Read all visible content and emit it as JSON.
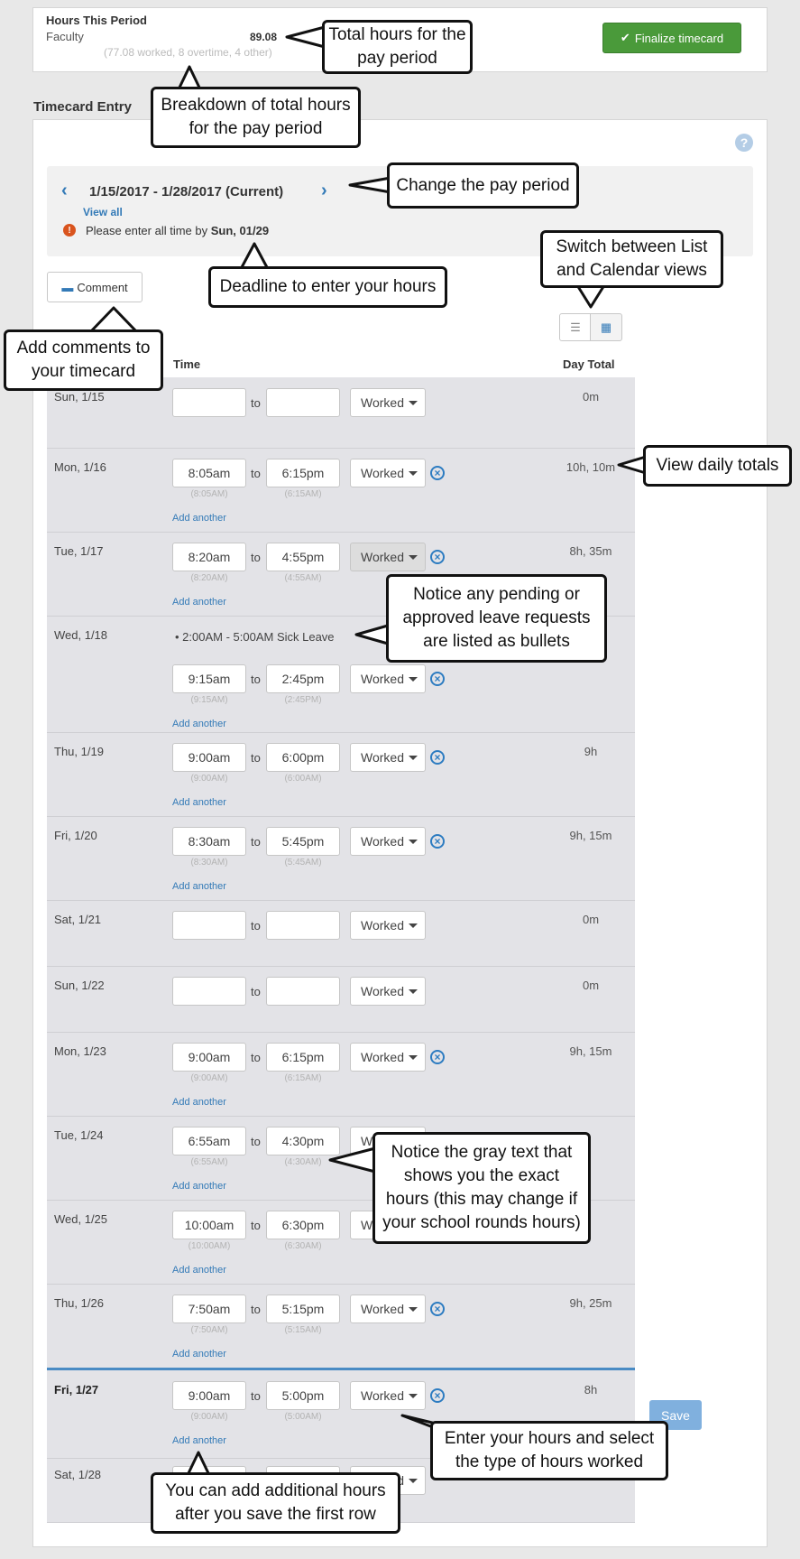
{
  "summary": {
    "label": "Hours This Period",
    "category": "Faculty",
    "total": "89.08",
    "breakdown": "(77.08 worked, 8 overtime, 4 other)",
    "finalize_label": "Finalize timecard"
  },
  "entry": {
    "heading": "Timecard Entry",
    "period": "1/15/2017 - 1/28/2017 (Current)",
    "view_all": "View all",
    "deadline_text": "Please enter all time by",
    "deadline_date": "Sun, 01/29",
    "comment_label": "Comment",
    "col_time": "Time",
    "col_day_total": "Day Total",
    "to_label": "to",
    "add_another": "Add another",
    "save_label": "Save",
    "leave_bullet": "2:00AM - 5:00AM Sick Leave"
  },
  "rows": [
    {
      "day": "Sun, 1/15",
      "start": "",
      "end": "",
      "start_hint": "",
      "end_hint": "",
      "type": "Worked",
      "total": "0m"
    },
    {
      "day": "Mon, 1/16",
      "start": "8:05am",
      "end": "6:15pm",
      "start_hint": "(8:05AM)",
      "end_hint": "(6:15AM)",
      "type": "Worked",
      "total": "10h, 10m"
    },
    {
      "day": "Tue, 1/17",
      "start": "8:20am",
      "end": "4:55pm",
      "start_hint": "(8:20AM)",
      "end_hint": "(4:55AM)",
      "type": "Worked",
      "total": "8h, 35m"
    },
    {
      "day": "Wed, 1/18",
      "start": "9:15am",
      "end": "2:45pm",
      "start_hint": "(9:15AM)",
      "end_hint": "(2:45PM)",
      "type": "Worked",
      "total": ""
    },
    {
      "day": "Thu, 1/19",
      "start": "9:00am",
      "end": "6:00pm",
      "start_hint": "(9:00AM)",
      "end_hint": "(6:00AM)",
      "type": "Worked",
      "total": "9h"
    },
    {
      "day": "Fri, 1/20",
      "start": "8:30am",
      "end": "5:45pm",
      "start_hint": "(8:30AM)",
      "end_hint": "(5:45AM)",
      "type": "Worked",
      "total": "9h, 15m"
    },
    {
      "day": "Sat, 1/21",
      "start": "",
      "end": "",
      "start_hint": "",
      "end_hint": "",
      "type": "Worked",
      "total": "0m"
    },
    {
      "day": "Sun, 1/22",
      "start": "",
      "end": "",
      "start_hint": "",
      "end_hint": "",
      "type": "Worked",
      "total": "0m"
    },
    {
      "day": "Mon, 1/23",
      "start": "9:00am",
      "end": "6:15pm",
      "start_hint": "(9:00AM)",
      "end_hint": "(6:15AM)",
      "type": "Worked",
      "total": "9h, 15m"
    },
    {
      "day": "Tue, 1/24",
      "start": "6:55am",
      "end": "4:30pm",
      "start_hint": "(6:55AM)",
      "end_hint": "(4:30AM)",
      "type": "Worked",
      "total": ""
    },
    {
      "day": "Wed, 1/25",
      "start": "10:00am",
      "end": "6:30pm",
      "start_hint": "(10:00AM)",
      "end_hint": "(6:30AM)",
      "type": "Worked",
      "total": ""
    },
    {
      "day": "Thu, 1/26",
      "start": "7:50am",
      "end": "5:15pm",
      "start_hint": "(7:50AM)",
      "end_hint": "(5:15AM)",
      "type": "Worked",
      "total": "9h, 25m"
    },
    {
      "day": "Fri, 1/27",
      "start": "9:00am",
      "end": "5:00pm",
      "start_hint": "(9:00AM)",
      "end_hint": "(5:00AM)",
      "type": "Worked",
      "total": "8h"
    },
    {
      "day": "Sat, 1/28",
      "start": "",
      "end": "",
      "start_hint": "",
      "end_hint": "",
      "type": "Worked",
      "total": ""
    }
  ],
  "callouts": {
    "total_hours": "Total hours for the pay period",
    "breakdown": "Breakdown of total hours for the pay period",
    "change_period": "Change the pay period",
    "switch_view": "Switch between List and Calendar views",
    "deadline": "Deadline to enter your hours",
    "comments": "Add comments to your timecard",
    "daily_totals": "View daily totals",
    "leave": "Notice any pending or approved leave requests are listed as bullets",
    "gray_text": "Notice the gray text that shows you the exact hours (this may change if your school rounds hours)",
    "enter_hours": "Enter your hours and select the type of hours worked",
    "add_more": "You can add additional hours after you save the first row"
  },
  "colors": {
    "accent": "#337ab7",
    "finalize": "#4a9a3a",
    "today_border": "#4a8bc4"
  }
}
